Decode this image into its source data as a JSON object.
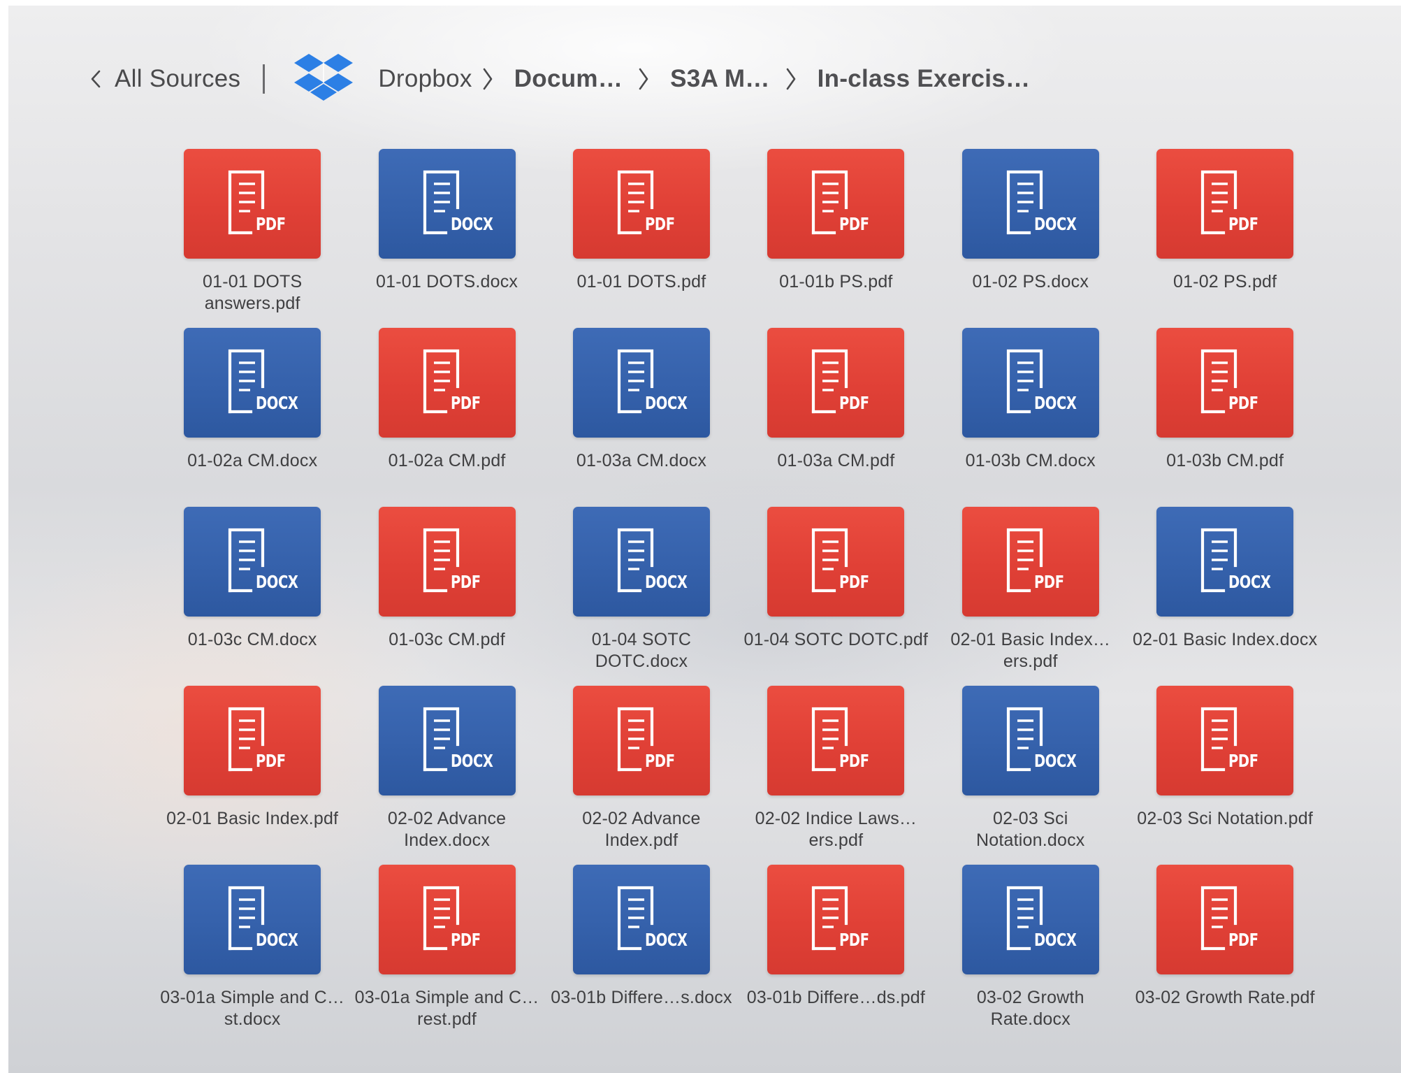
{
  "breadcrumb": {
    "back_label": "All Sources",
    "root_label": "Dropbox",
    "path": [
      "Docum…",
      "S3A M…",
      "In-class Exercis…"
    ]
  },
  "colors": {
    "pdf_tile": "#e04036",
    "docx_tile": "#3561ab",
    "dropbox_blue": "#2c7fe5",
    "text": "#3f3f41"
  },
  "icons": {
    "back": "chevron-left-icon",
    "separator": "chevron-right-icon",
    "source": "dropbox-logo-icon",
    "file": "document-icon"
  },
  "files": [
    {
      "name": "01-01 DOTS answers.pdf",
      "type": "pdf",
      "badge": "PDF"
    },
    {
      "name": "01-01 DOTS.docx",
      "type": "docx",
      "badge": "DOCX"
    },
    {
      "name": "01-01 DOTS.pdf",
      "type": "pdf",
      "badge": "PDF"
    },
    {
      "name": "01-01b PS.pdf",
      "type": "pdf",
      "badge": "PDF"
    },
    {
      "name": "01-02 PS.docx",
      "type": "docx",
      "badge": "DOCX"
    },
    {
      "name": "01-02 PS.pdf",
      "type": "pdf",
      "badge": "PDF"
    },
    {
      "name": "01-02a CM.docx",
      "type": "docx",
      "badge": "DOCX"
    },
    {
      "name": "01-02a CM.pdf",
      "type": "pdf",
      "badge": "PDF"
    },
    {
      "name": "01-03a CM.docx",
      "type": "docx",
      "badge": "DOCX"
    },
    {
      "name": "01-03a CM.pdf",
      "type": "pdf",
      "badge": "PDF"
    },
    {
      "name": "01-03b CM.docx",
      "type": "docx",
      "badge": "DOCX"
    },
    {
      "name": "01-03b CM.pdf",
      "type": "pdf",
      "badge": "PDF"
    },
    {
      "name": "01-03c CM.docx",
      "type": "docx",
      "badge": "DOCX"
    },
    {
      "name": "01-03c CM.pdf",
      "type": "pdf",
      "badge": "PDF"
    },
    {
      "name": "01-04 SOTC DOTC.docx",
      "type": "docx",
      "badge": "DOCX"
    },
    {
      "name": "01-04 SOTC DOTC.pdf",
      "type": "pdf",
      "badge": "PDF"
    },
    {
      "name": "02-01 Basic Index…ers.pdf",
      "type": "pdf",
      "badge": "PDF"
    },
    {
      "name": "02-01 Basic Index.docx",
      "type": "docx",
      "badge": "DOCX"
    },
    {
      "name": "02-01 Basic Index.pdf",
      "type": "pdf",
      "badge": "PDF"
    },
    {
      "name": "02-02 Advance Index.docx",
      "type": "docx",
      "badge": "DOCX"
    },
    {
      "name": "02-02 Advance Index.pdf",
      "type": "pdf",
      "badge": "PDF"
    },
    {
      "name": "02-02 Indice Laws…ers.pdf",
      "type": "pdf",
      "badge": "PDF"
    },
    {
      "name": "02-03 Sci Notation.docx",
      "type": "docx",
      "badge": "DOCX"
    },
    {
      "name": "02-03 Sci Notation.pdf",
      "type": "pdf",
      "badge": "PDF"
    },
    {
      "name": "03-01a Simple and C…st.docx",
      "type": "docx",
      "badge": "DOCX"
    },
    {
      "name": "03-01a Simple and C…rest.pdf",
      "type": "pdf",
      "badge": "PDF"
    },
    {
      "name": "03-01b Differe…s.docx",
      "type": "docx",
      "badge": "DOCX"
    },
    {
      "name": "03-01b Differe…ds.pdf",
      "type": "pdf",
      "badge": "PDF"
    },
    {
      "name": "03-02 Growth Rate.docx",
      "type": "docx",
      "badge": "DOCX"
    },
    {
      "name": "03-02 Growth Rate.pdf",
      "type": "pdf",
      "badge": "PDF"
    }
  ]
}
